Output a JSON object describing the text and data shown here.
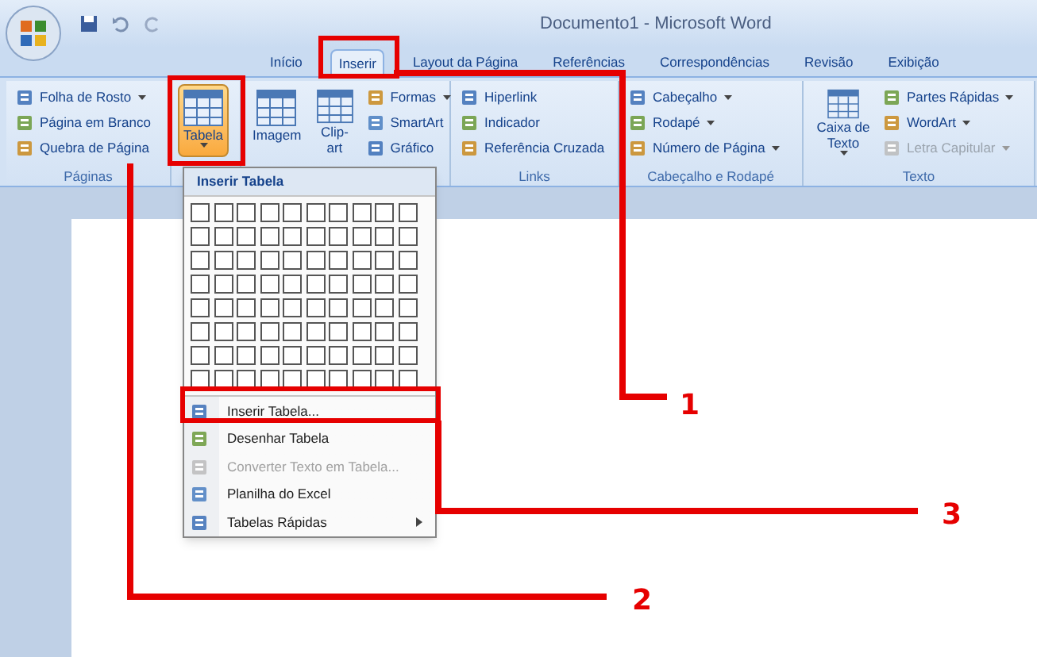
{
  "window": {
    "title": "Documento1 - Microsoft Word"
  },
  "tabs": [
    {
      "label": "Início",
      "selected": false
    },
    {
      "label": "Inserir",
      "selected": true
    },
    {
      "label": "Layout da Página",
      "selected": false
    },
    {
      "label": "Referências",
      "selected": false
    },
    {
      "label": "Correspondências",
      "selected": false
    },
    {
      "label": "Revisão",
      "selected": false
    },
    {
      "label": "Exibição",
      "selected": false
    }
  ],
  "ribbon": {
    "groups": [
      {
        "label": "Páginas",
        "items": [
          {
            "kind": "small",
            "label": "Folha de Rosto",
            "dropdown": true,
            "disabled": false
          },
          {
            "kind": "small",
            "label": "Página em Branco",
            "dropdown": false,
            "disabled": false
          },
          {
            "kind": "small",
            "label": "Quebra de Página",
            "dropdown": false,
            "disabled": false
          }
        ]
      },
      {
        "items": [
          {
            "kind": "large",
            "label": "Tabela",
            "dropdown": true,
            "active": true
          }
        ]
      },
      {
        "items": [
          {
            "kind": "large",
            "label": "Imagem",
            "dropdown": false,
            "active": false
          },
          {
            "kind": "large",
            "label": "Clip-art",
            "dropdown": false,
            "active": false
          },
          {
            "kind": "small",
            "label": "Formas",
            "dropdown": true,
            "disabled": false
          },
          {
            "kind": "small",
            "label": "SmartArt",
            "dropdown": false,
            "disabled": false
          },
          {
            "kind": "small",
            "label": "Gráfico",
            "dropdown": false,
            "disabled": false
          }
        ]
      },
      {
        "label": "Links",
        "items": [
          {
            "kind": "small",
            "label": "Hiperlink",
            "dropdown": false,
            "disabled": false
          },
          {
            "kind": "small",
            "label": "Indicador",
            "dropdown": false,
            "disabled": false
          },
          {
            "kind": "small",
            "label": "Referência Cruzada",
            "dropdown": false,
            "disabled": false
          }
        ]
      },
      {
        "label": "Cabeçalho e Rodapé",
        "items": [
          {
            "kind": "small",
            "label": "Cabeçalho",
            "dropdown": true,
            "disabled": false
          },
          {
            "kind": "small",
            "label": "Rodapé",
            "dropdown": true,
            "disabled": false
          },
          {
            "kind": "small",
            "label": "Número de Página",
            "dropdown": true,
            "disabled": false
          }
        ]
      },
      {
        "label": "Texto",
        "items": [
          {
            "kind": "large",
            "label": "Caixa de Texto",
            "dropdown": true,
            "active": false
          },
          {
            "kind": "small",
            "label": "Partes Rápidas",
            "dropdown": true,
            "disabled": false
          },
          {
            "kind": "small",
            "label": "WordArt",
            "dropdown": true,
            "disabled": false
          },
          {
            "kind": "small",
            "label": "Letra Capitular",
            "dropdown": true,
            "disabled": true
          }
        ]
      }
    ]
  },
  "menu": {
    "header": "Inserir Tabela",
    "items": [
      {
        "label": "Inserir Tabela...",
        "disabled": false,
        "submenu": false
      },
      {
        "label": "Desenhar Tabela",
        "disabled": false,
        "submenu": false
      },
      {
        "label": "Converter Texto em Tabela...",
        "disabled": true,
        "submenu": false
      },
      {
        "label": "Planilha do Excel",
        "disabled": false,
        "submenu": false
      },
      {
        "label": "Tabelas Rápidas",
        "disabled": false,
        "submenu": true
      }
    ]
  },
  "annotations": [
    {
      "label": "1"
    },
    {
      "label": "2"
    },
    {
      "label": "3"
    }
  ]
}
